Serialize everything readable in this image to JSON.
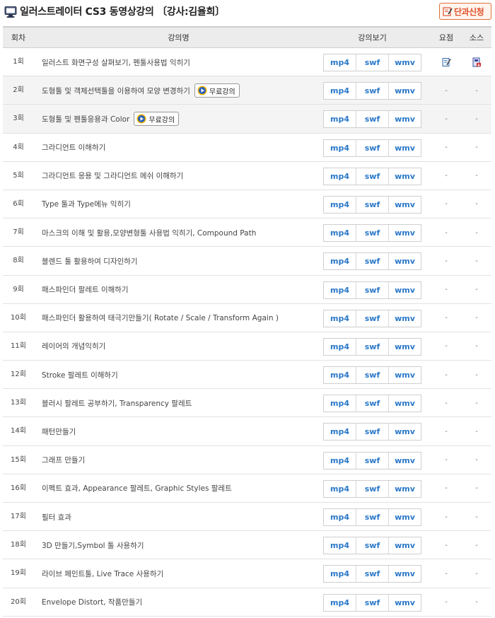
{
  "header": {
    "title": "일러스트레이터 CS3 동영상강의 〔강사:김율희〕",
    "apply_label": "단과신청"
  },
  "columns": {
    "num": "회차",
    "title": "강의명",
    "view": "강의보기",
    "summary": "요점",
    "source": "소스"
  },
  "formats": [
    "mp4",
    "swf",
    "wmv"
  ],
  "free_label": "무료강의",
  "dash": "-",
  "lectures": [
    {
      "num": "1회",
      "title": "일러스트 화면구성 살펴보기, 펜툴사용법 익히기",
      "free": false,
      "summary_icon": "memo-icon",
      "source_icon": "download-file-icon"
    },
    {
      "num": "2회",
      "title": "도형툴 및 객체선택툴을 이용하여 모양 변경하기",
      "free": true
    },
    {
      "num": "3회",
      "title": "도형툴 및 펜툴응용과 Color",
      "free": true
    },
    {
      "num": "4회",
      "title": "그라디언트 이해하기",
      "free": false
    },
    {
      "num": "5회",
      "title": "그라디언트 응용 및 그라디언트 메쉬 이해하기",
      "free": false
    },
    {
      "num": "6회",
      "title": "Type 툴과 Type메뉴 익히기",
      "free": false
    },
    {
      "num": "7회",
      "title": "마스크의 이해 및 활용,모양변형툴 사용법 익히기, Compound Path",
      "free": false
    },
    {
      "num": "8회",
      "title": "블렌드 툴 활용하여 디자인하기",
      "free": false
    },
    {
      "num": "9회",
      "title": "패스파인더 팔레트 이해하기",
      "free": false
    },
    {
      "num": "10회",
      "title": "패스파인더 활용하여 태극기만들기( Rotate / Scale / Transform Again )",
      "free": false
    },
    {
      "num": "11회",
      "title": "레이어의 개념익히기",
      "free": false
    },
    {
      "num": "12회",
      "title": "Stroke 팔레트 이해하기",
      "free": false
    },
    {
      "num": "13회",
      "title": "블러시 팔레트 공부하기, Transparency 팔레트",
      "free": false
    },
    {
      "num": "14회",
      "title": "패턴만들기",
      "free": false
    },
    {
      "num": "15회",
      "title": "그래프 만들기",
      "free": false
    },
    {
      "num": "16회",
      "title": "이펙트 효과, Appearance 팔레트, Graphic Styles 팔레트",
      "free": false
    },
    {
      "num": "17회",
      "title": "필터 효과",
      "free": false
    },
    {
      "num": "18회",
      "title": "3D 만들기,Symbol 툴 사용하기",
      "free": false
    },
    {
      "num": "19회",
      "title": "라이브 페인트툴, Live Trace 사용하기",
      "free": false
    },
    {
      "num": "20회",
      "title": "Envelope Distort, 작품만들기",
      "free": false
    }
  ],
  "colors": {
    "format_link": "#2a78c8",
    "apply_accent": "#e0502a",
    "header_bg": "#ececec"
  }
}
